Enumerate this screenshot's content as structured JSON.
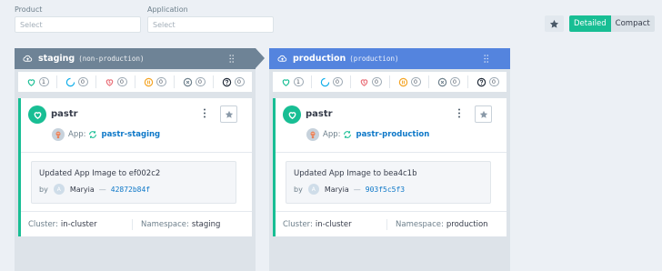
{
  "filters": {
    "product": {
      "label": "Product",
      "placeholder": "Select"
    },
    "application": {
      "label": "Application",
      "placeholder": "Select"
    }
  },
  "view_toggle": {
    "detailed": "Detailed",
    "compact": "Compact",
    "active": "Detailed"
  },
  "colors": {
    "staging_header": "#6e8396",
    "production_header": "#5484de",
    "healthy": "#18be94",
    "link": "#0e78c8"
  },
  "environments": [
    {
      "name": "staging",
      "tag": "(non-production)",
      "status_counts": {
        "healthy": "1",
        "progressing": "0",
        "degraded": "0",
        "suspended": "0",
        "missing": "0",
        "unknown": "0"
      },
      "card": {
        "app_name": "pastr",
        "app_label": "App:",
        "app_link": "pastr-staging",
        "commit_message": "Updated App Image to ef002c2",
        "by_label": "by",
        "user_initial": "A",
        "user_name": "Maryia",
        "sha": "42872b84f",
        "cluster_key": "Cluster:",
        "cluster_val": "in-cluster",
        "ns_key": "Namespace:",
        "ns_val": "staging"
      }
    },
    {
      "name": "production",
      "tag": "(production)",
      "status_counts": {
        "healthy": "1",
        "progressing": "0",
        "degraded": "0",
        "suspended": "0",
        "missing": "0",
        "unknown": "0"
      },
      "card": {
        "app_name": "pastr",
        "app_label": "App:",
        "app_link": "pastr-production",
        "commit_message": "Updated App Image to bea4c1b",
        "by_label": "by",
        "user_initial": "A",
        "user_name": "Maryia",
        "sha": "903f5c5f3",
        "cluster_key": "Cluster:",
        "cluster_val": "in-cluster",
        "ns_key": "Namespace:",
        "ns_val": "production"
      }
    }
  ]
}
